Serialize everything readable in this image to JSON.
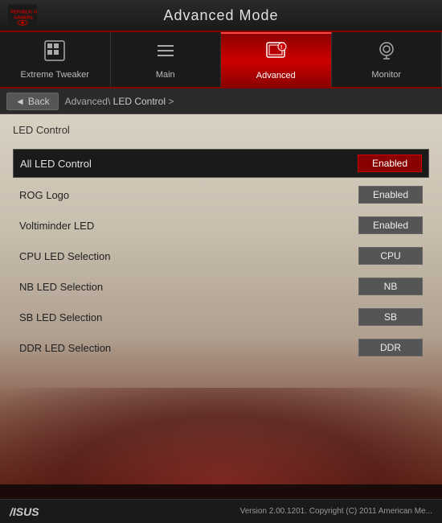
{
  "header": {
    "title": "Advanced Mode",
    "logo_alt": "Republic of Gamers"
  },
  "nav": {
    "tabs": [
      {
        "id": "extreme-tweaker",
        "label": "Extreme Tweaker",
        "icon": "⊞",
        "active": false
      },
      {
        "id": "main",
        "label": "Main",
        "icon": "≡",
        "active": false
      },
      {
        "id": "advanced",
        "label": "Advanced",
        "icon": "⚙",
        "active": true
      },
      {
        "id": "monitor",
        "label": "Monitor",
        "icon": "◎",
        "active": false
      }
    ]
  },
  "breadcrumb": {
    "back_label": "Back",
    "path": "Advanced\\",
    "current": "LED Control",
    "arrow": ">"
  },
  "content": {
    "section_title": "LED Control",
    "settings": [
      {
        "label": "All LED Control",
        "value": "Enabled",
        "highlighted": true,
        "value_red": true
      },
      {
        "label": "ROG Logo",
        "value": "Enabled",
        "highlighted": false,
        "value_red": false
      },
      {
        "label": "Voltiminder LED",
        "value": "Enabled",
        "highlighted": false,
        "value_red": false
      },
      {
        "label": "CPU LED Selection",
        "value": "CPU",
        "highlighted": false,
        "value_red": false
      },
      {
        "label": "NB LED Selection",
        "value": "NB",
        "highlighted": false,
        "value_red": false
      },
      {
        "label": "SB LED Selection",
        "value": "SB",
        "highlighted": false,
        "value_red": false
      },
      {
        "label": "DDR LED Selection",
        "value": "DDR",
        "highlighted": false,
        "value_red": false
      }
    ]
  },
  "footer": {
    "logo": "/ISUS",
    "version": "Version 2.00.1201. Copyright (C) 2011 American Me..."
  }
}
